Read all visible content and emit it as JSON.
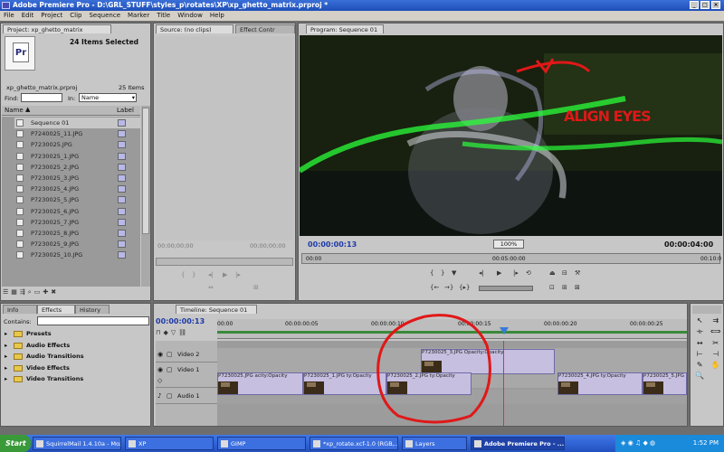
{
  "window": {
    "title": "Adobe Premiere Pro - D:\\GRL_STUFF\\styles_p\\rotates\\XP\\xp_ghetto_matrix.prproj *"
  },
  "menu": [
    "File",
    "Edit",
    "Project",
    "Clip",
    "Sequence",
    "Marker",
    "Title",
    "Window",
    "Help"
  ],
  "project_panel": {
    "tab": "Project: xp_ghetto_matrix",
    "items_selected": "24 Items Selected",
    "file_name": "xp_ghetto_matrix.prproj",
    "item_count": "25 Items",
    "find_label": "Find:",
    "in_label": "In:",
    "in_value": "Name",
    "col_name": "Name",
    "col_label": "Label",
    "items": [
      "Sequence 01",
      "P7240025_11.JPG",
      "P7230025.JPG",
      "P7230025_1.JPG",
      "P7230025_2.JPG",
      "P7230025_3.JPG",
      "P7230025_4.JPG",
      "P7230025_5.JPG",
      "P7230025_6.JPG",
      "P7230025_7.JPG",
      "P7230025_8.JPG",
      "P7230025_9.JPG",
      "P7230025_10.JPG"
    ]
  },
  "source_panel": {
    "tab": "Source: (no clips)",
    "tab2": "Effect Contr",
    "timecode_left": "00;00;00;00",
    "timecode_right": "00;00;00;00"
  },
  "program_panel": {
    "tab": "Program: Sequence 01",
    "timecode": "00:00:00:13",
    "zoom": "100%",
    "duration": "00:00:04:00",
    "ruler": [
      "00:00",
      "00:05:00:00",
      "00:10:0"
    ],
    "annotation": "ALIGN EYES"
  },
  "effects_panel": {
    "tabs": [
      "Info",
      "Effects",
      "History"
    ],
    "contains_label": "Contains:",
    "folders": [
      "Presets",
      "Audio Effects",
      "Audio Transitions",
      "Video Effects",
      "Video Transitions"
    ]
  },
  "timeline": {
    "tab": "Timeline: Sequence 01",
    "timecode": "00:00:00:13",
    "ruler": [
      "00:00",
      "00:00:00:05",
      "00:00:00:10",
      "00:00:00:15",
      "00:00:00:20",
      "00:00:00:25"
    ],
    "tracks": {
      "video2": "Video 2",
      "video1": "Video 1",
      "audio1": "Audio 1"
    },
    "clips_v2": [
      "P7230025_3.JPG Opacity:Opacity"
    ],
    "clips_v1": [
      "P7230025.JPG",
      "acity:Opacity",
      "P7230025_1.JPG",
      "ty:Opacity",
      "P7230025_2.JPG",
      "ty:Opacity",
      "P7230025_4.JPG",
      "ty:Opacity",
      "P7230025_5.JPG"
    ]
  },
  "taskbar": {
    "start": "Start",
    "items": [
      "SquirrelMail 1.4.10a - Moz...",
      "XP",
      "GIMP",
      "*xp_rotate.xcf-1.0 (RGB,...",
      "Layers",
      "Adobe Premiere Pro - ..."
    ],
    "clock": "1:52 PM"
  },
  "colors": {
    "titlebar": "#1f4fb8",
    "annotation": "#e01818",
    "clip": "#c7bfe0",
    "playhead": "#e03030"
  }
}
